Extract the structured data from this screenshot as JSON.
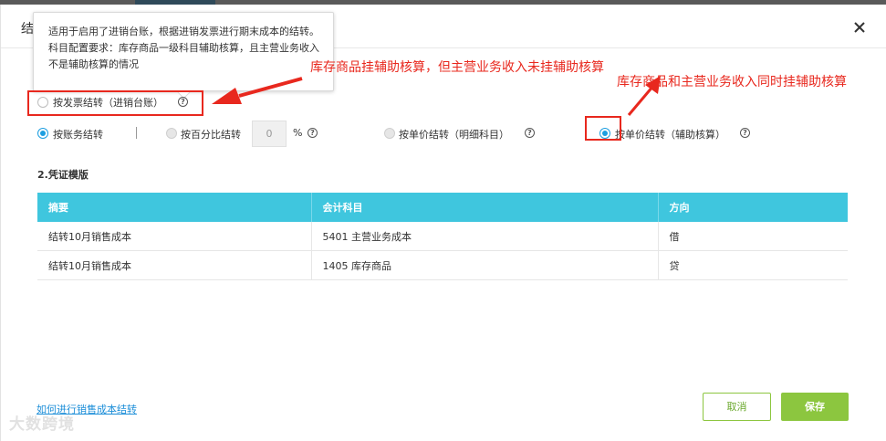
{
  "dialog": {
    "title_fragment": "结",
    "close_icon": "close-icon"
  },
  "tooltip": {
    "text": "适用于启用了进销台账，根据进销发票进行期末成本的结转。科目配置要求：库存商品一级科目辅助核算，且主营业务收入不是辅助核算的情况"
  },
  "options": {
    "invoice": {
      "label": "按发票结转（进销台账）",
      "selected": false
    },
    "ledger": {
      "label": "按账务结转",
      "selected": true
    },
    "percent": {
      "label": "按百分比结转",
      "selected": false,
      "value": "0",
      "unit": "%"
    },
    "unit_detail": {
      "label": "按单价结转（明细科目）",
      "selected": false
    },
    "unit_aux": {
      "label": "按单价结转（辅助核算）",
      "selected": true
    }
  },
  "voucher": {
    "section_title": "2.凭证模版",
    "columns": [
      "摘要",
      "会计科目",
      "方向"
    ],
    "rows": [
      [
        "结转10月销售成本",
        "5401 主营业务成本",
        "借"
      ],
      [
        "结转10月销售成本",
        "1405 库存商品",
        "贷"
      ]
    ]
  },
  "footer": {
    "help_link": "如何进行销售成本结转",
    "cancel_label": "取消",
    "save_label": "保存"
  },
  "annotations": {
    "left": "库存商品挂辅助核算，但主营业务收入未挂辅助核算",
    "right": "库存商品和主营业务收入同时挂辅助核算"
  },
  "colors": {
    "accent_blue": "#1c9ee0",
    "table_header": "#3fc6de",
    "save_green": "#8cc63f",
    "annotation_red": "#e8281e"
  },
  "watermark": "大数跨境"
}
